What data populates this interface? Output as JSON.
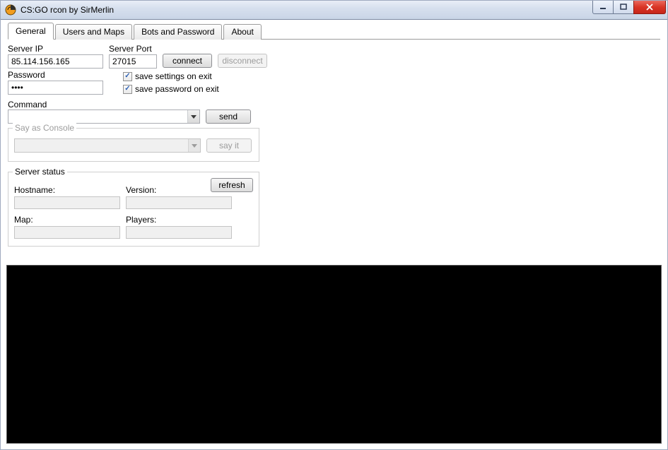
{
  "window": {
    "title": "CS:GO rcon by SirMerlin"
  },
  "tabs": [
    {
      "label": "General"
    },
    {
      "label": "Users and Maps"
    },
    {
      "label": "Bots and Password"
    },
    {
      "label": "About"
    }
  ],
  "fields": {
    "serverIpLabel": "Server IP",
    "serverIpValue": "85.114.156.165",
    "serverPortLabel": "Server Port",
    "serverPortValue": "27015",
    "passwordLabel": "Password",
    "passwordValue": "••••",
    "commandLabel": "Command",
    "commandValue": ""
  },
  "buttons": {
    "connect": "connect",
    "disconnect": "disconnect",
    "send": "send",
    "sayIt": "say it",
    "refresh": "refresh"
  },
  "checkboxes": {
    "saveSettings": "save settings on exit",
    "savePassword": "save password on exit"
  },
  "sayGroup": {
    "legend": "Say as Console",
    "value": ""
  },
  "statusGroup": {
    "legend": "Server status",
    "hostnameLabel": "Hostname:",
    "hostnameValue": "",
    "versionLabel": "Version:",
    "versionValue": "",
    "mapLabel": "Map:",
    "mapValue": "",
    "playersLabel": "Players:",
    "playersValue": ""
  }
}
